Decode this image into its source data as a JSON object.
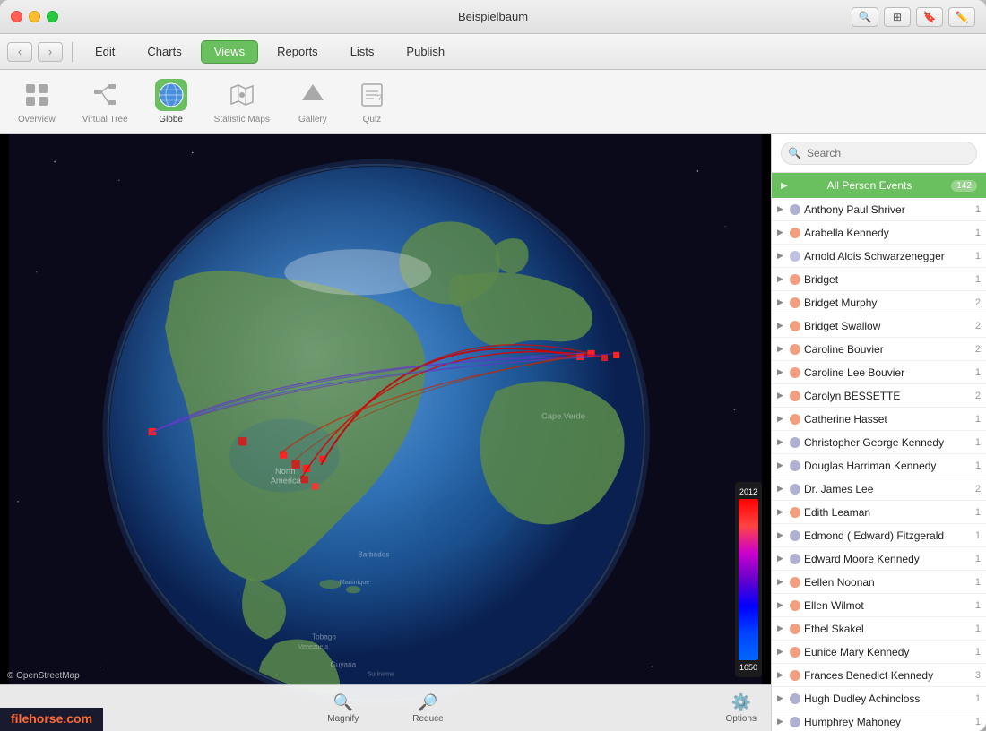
{
  "window": {
    "title": "Beispielbaum"
  },
  "titlebar": {
    "back_label": "‹",
    "forward_label": "›"
  },
  "navbar": {
    "tabs": [
      {
        "id": "edit",
        "label": "Edit",
        "active": false
      },
      {
        "id": "charts",
        "label": "Charts",
        "active": false
      },
      {
        "id": "views",
        "label": "Views",
        "active": true
      },
      {
        "id": "reports",
        "label": "Reports",
        "active": false
      },
      {
        "id": "lists",
        "label": "Lists",
        "active": false
      },
      {
        "id": "publish",
        "label": "Publish",
        "active": false
      }
    ]
  },
  "toolbar": {
    "items": [
      {
        "id": "overview",
        "label": "Overview",
        "active": false
      },
      {
        "id": "virtual-tree",
        "label": "Virtual Tree",
        "active": false
      },
      {
        "id": "globe",
        "label": "Globe",
        "active": true
      },
      {
        "id": "statistic-maps",
        "label": "Statistic Maps",
        "active": false
      },
      {
        "id": "gallery",
        "label": "Gallery",
        "active": false
      },
      {
        "id": "quiz",
        "label": "Quiz",
        "active": false
      }
    ]
  },
  "globe": {
    "osm_credit": "© OpenStreetMap"
  },
  "timeline": {
    "year_top": "2012",
    "year_bottom": "1650"
  },
  "bottom_bar": {
    "magnify_label": "Magnify",
    "reduce_label": "Reduce",
    "options_label": "Options"
  },
  "right_panel": {
    "search_placeholder": "Search",
    "list_header_label": "All Person Events",
    "list_header_count": "142",
    "persons": [
      {
        "name": "Anthony Paul Shriver",
        "count": "1",
        "color": "#b0b0d0"
      },
      {
        "name": "Arabella Kennedy",
        "count": "1",
        "color": "#f0a080"
      },
      {
        "name": "Arnold Alois Schwarzenegger",
        "count": "1",
        "color": "#c0c0e0"
      },
      {
        "name": "Bridget",
        "count": "1",
        "color": "#f0a080"
      },
      {
        "name": "Bridget Murphy",
        "count": "2",
        "color": "#f0a080"
      },
      {
        "name": "Bridget Swallow",
        "count": "2",
        "color": "#f0a080"
      },
      {
        "name": "Caroline Bouvier",
        "count": "2",
        "color": "#f0a080"
      },
      {
        "name": "Caroline Lee Bouvier",
        "count": "1",
        "color": "#f0a080"
      },
      {
        "name": "Carolyn BESSETTE",
        "count": "2",
        "color": "#f0a080"
      },
      {
        "name": "Catherine Hasset",
        "count": "1",
        "color": "#f0a080"
      },
      {
        "name": "Christopher George Kennedy",
        "count": "1",
        "color": "#b0b0d0"
      },
      {
        "name": "Douglas Harriman Kennedy",
        "count": "1",
        "color": "#b0b0d0"
      },
      {
        "name": "Dr. James Lee",
        "count": "2",
        "color": "#b0b0d0"
      },
      {
        "name": "Edith Leaman",
        "count": "1",
        "color": "#f0a080"
      },
      {
        "name": "Edmond ( Edward) Fitzgerald",
        "count": "1",
        "color": "#b0b0d0"
      },
      {
        "name": "Edward Moore Kennedy",
        "count": "1",
        "color": "#b0b0d0"
      },
      {
        "name": "Eellen Noonan",
        "count": "1",
        "color": "#f0a080"
      },
      {
        "name": "Ellen Wilmot",
        "count": "1",
        "color": "#f0a080"
      },
      {
        "name": "Ethel Skakel",
        "count": "1",
        "color": "#f0a080"
      },
      {
        "name": "Eunice Mary Kennedy",
        "count": "1",
        "color": "#f0a080"
      },
      {
        "name": "Frances Benedict Kennedy",
        "count": "3",
        "color": "#f0a080"
      },
      {
        "name": "Hugh Dudley Achincloss",
        "count": "1",
        "color": "#b0b0d0"
      },
      {
        "name": "Humphrey Mahoney",
        "count": "1",
        "color": "#b0b0d0"
      }
    ]
  },
  "watermark": {
    "prefix": "file",
    "highlight": "horse",
    "suffix": ".com"
  }
}
